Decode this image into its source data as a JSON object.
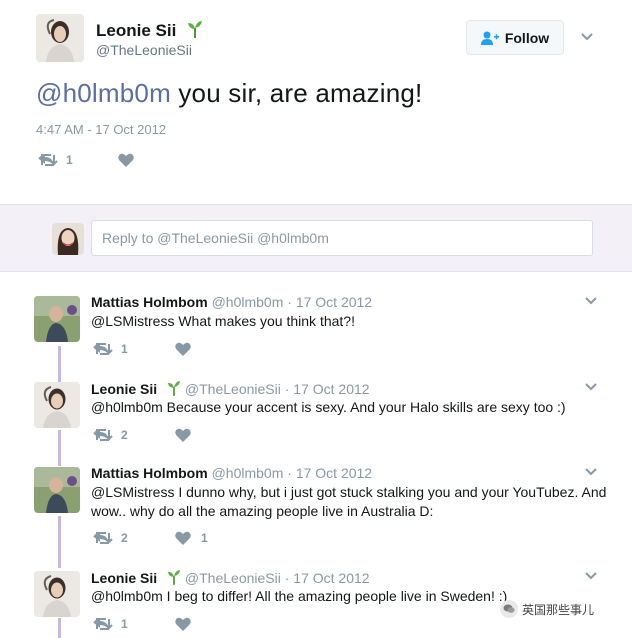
{
  "main_tweet": {
    "name": "Leonie Sii",
    "handle": "@TheLeonieSii",
    "follow_label": "Follow",
    "mention": "@h0lmb0m",
    "text": " you sir, are amazing!",
    "timestamp": "4:47 AM - 17 Oct 2012",
    "reply_count": "1",
    "retweet_count": "",
    "like_count": ""
  },
  "reply_box": {
    "placeholder": "Reply to @TheLeonieSii @h0lmb0m"
  },
  "replies": [
    {
      "name": "Mattias Holmbom",
      "handle": "@h0lmb0m",
      "date": "· 17 Oct 2012",
      "text": "@LSMistress What makes you think that?!",
      "reply_count": "1",
      "retweet_count": "",
      "like_count": ""
    },
    {
      "name": "Leonie Sii",
      "handle": "@TheLeonieSii",
      "date": "· 17 Oct 2012",
      "text": "@h0lmb0m Because your accent is sexy. And your Halo skills are sexy too :)",
      "reply_count": "2",
      "retweet_count": "",
      "like_count": ""
    },
    {
      "name": "Mattias Holmbom",
      "handle": "@h0lmb0m",
      "date": "· 17 Oct 2012",
      "text": "@LSMistress I dunno why, but i just got stuck stalking you and your YouTubez. And wow.. why do all the amazing people live in Australia D:",
      "reply_count": "2",
      "retweet_count": "",
      "like_count": "1"
    },
    {
      "name": "Leonie Sii",
      "handle": "@TheLeonieSii",
      "date": "· 17 Oct 2012",
      "text": "@h0lmb0m I beg to differ! All the amazing people live in Sweden! :)",
      "reply_count": "1",
      "retweet_count": "",
      "like_count": ""
    }
  ],
  "watermark": {
    "text": "英国那些事儿"
  },
  "colors": {
    "mention": "#5a6e9f",
    "reply_box_bg": "#f4f0f8",
    "thread_line": "#c9b7de",
    "muted_text": "#8899a6",
    "sprout_green": "#4a9a3a"
  },
  "icons": [
    "sprout-icon",
    "add-user-icon",
    "chevron-down-icon",
    "reply-icon",
    "retweet-icon",
    "heart-icon",
    "wechat-icon"
  ]
}
